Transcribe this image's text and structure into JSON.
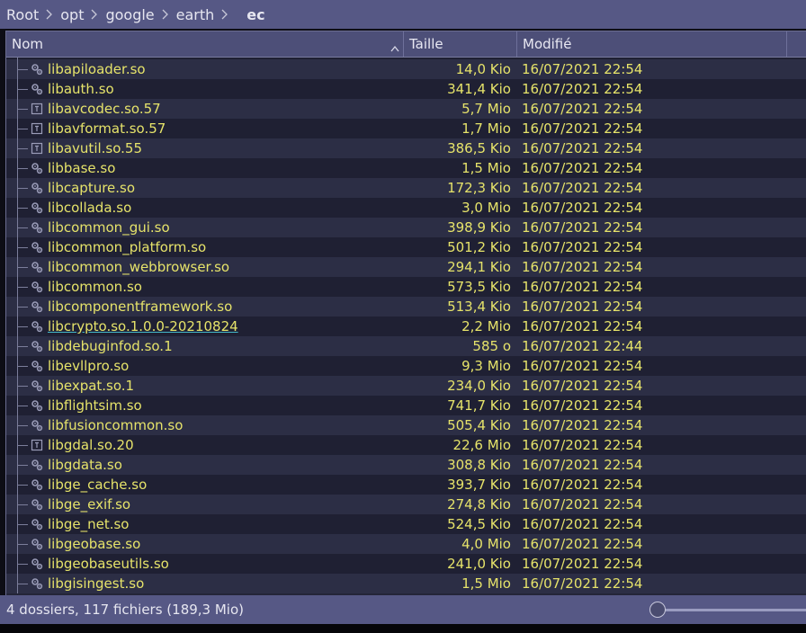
{
  "breadcrumb": {
    "items": [
      "Root",
      "opt",
      "google",
      "earth"
    ],
    "current": "ec"
  },
  "columns": {
    "name": "Nom",
    "size": "Taille",
    "modified": "Modifié"
  },
  "files": [
    {
      "name": "libapiloader.so",
      "size": "14,0 Kio",
      "date": "16/07/2021 22:54",
      "icon": "gear-icon"
    },
    {
      "name": "libauth.so",
      "size": "341,4 Kio",
      "date": "16/07/2021 22:54",
      "icon": "gear-icon"
    },
    {
      "name": "libavcodec.so.57",
      "size": "5,7 Mio",
      "date": "16/07/2021 22:54",
      "icon": "text-file-icon"
    },
    {
      "name": "libavformat.so.57",
      "size": "1,7 Mio",
      "date": "16/07/2021 22:54",
      "icon": "text-file-icon"
    },
    {
      "name": "libavutil.so.55",
      "size": "386,5 Kio",
      "date": "16/07/2021 22:54",
      "icon": "text-file-icon"
    },
    {
      "name": "libbase.so",
      "size": "1,5 Mio",
      "date": "16/07/2021 22:54",
      "icon": "gear-icon"
    },
    {
      "name": "libcapture.so",
      "size": "172,3 Kio",
      "date": "16/07/2021 22:54",
      "icon": "gear-icon"
    },
    {
      "name": "libcollada.so",
      "size": "3,0 Mio",
      "date": "16/07/2021 22:54",
      "icon": "gear-icon"
    },
    {
      "name": "libcommon_gui.so",
      "size": "398,9 Kio",
      "date": "16/07/2021 22:54",
      "icon": "gear-icon"
    },
    {
      "name": "libcommon_platform.so",
      "size": "501,2 Kio",
      "date": "16/07/2021 22:54",
      "icon": "gear-icon"
    },
    {
      "name": "libcommon_webbrowser.so",
      "size": "294,1 Kio",
      "date": "16/07/2021 22:54",
      "icon": "gear-icon"
    },
    {
      "name": "libcommon.so",
      "size": "573,5 Kio",
      "date": "16/07/2021 22:54",
      "icon": "gear-icon"
    },
    {
      "name": "libcomponentframework.so",
      "size": "513,4 Kio",
      "date": "16/07/2021 22:54",
      "icon": "gear-icon"
    },
    {
      "name": "libcrypto.so.1.0.0-20210824",
      "size": "2,2 Mio",
      "date": "16/07/2021 22:54",
      "icon": "gear-icon",
      "link": true
    },
    {
      "name": "libdebuginfod.so.1",
      "size": "585 o",
      "date": "16/07/2021 22:44",
      "icon": "gear-icon"
    },
    {
      "name": "libevllpro.so",
      "size": "9,3 Mio",
      "date": "16/07/2021 22:54",
      "icon": "gear-icon"
    },
    {
      "name": "libexpat.so.1",
      "size": "234,0 Kio",
      "date": "16/07/2021 22:54",
      "icon": "gear-icon"
    },
    {
      "name": "libflightsim.so",
      "size": "741,7 Kio",
      "date": "16/07/2021 22:54",
      "icon": "gear-icon"
    },
    {
      "name": "libfusioncommon.so",
      "size": "505,4 Kio",
      "date": "16/07/2021 22:54",
      "icon": "gear-icon"
    },
    {
      "name": "libgdal.so.20",
      "size": "22,6 Mio",
      "date": "16/07/2021 22:54",
      "icon": "text-file-icon"
    },
    {
      "name": "libgdata.so",
      "size": "308,8 Kio",
      "date": "16/07/2021 22:54",
      "icon": "gear-icon"
    },
    {
      "name": "libge_cache.so",
      "size": "393,7 Kio",
      "date": "16/07/2021 22:54",
      "icon": "gear-icon"
    },
    {
      "name": "libge_exif.so",
      "size": "274,8 Kio",
      "date": "16/07/2021 22:54",
      "icon": "gear-icon"
    },
    {
      "name": "libge_net.so",
      "size": "524,5 Kio",
      "date": "16/07/2021 22:54",
      "icon": "gear-icon"
    },
    {
      "name": "libgeobase.so",
      "size": "4,0 Mio",
      "date": "16/07/2021 22:54",
      "icon": "gear-icon"
    },
    {
      "name": "libgeobaseutils.so",
      "size": "241,0 Kio",
      "date": "16/07/2021 22:54",
      "icon": "gear-icon"
    },
    {
      "name": "libgisingest.so",
      "size": "1,5 Mio",
      "date": "16/07/2021 22:54",
      "icon": "gear-icon"
    }
  ],
  "status": {
    "summary": "4 dossiers, 117 fichiers (189,3 Mio)"
  },
  "colors": {
    "accent": "#565885",
    "filename": "#e6e36a",
    "background": "#242538"
  }
}
